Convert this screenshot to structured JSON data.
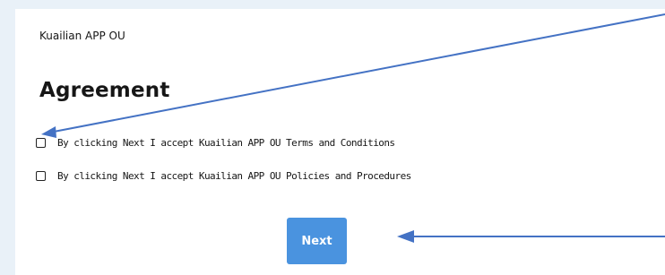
{
  "header": {
    "org_name": "Kuailian APP OU"
  },
  "agreement": {
    "title": "Agreement",
    "items": [
      {
        "label": "By clicking Next I accept Kuailian APP OU Terms and Conditions",
        "checked": false
      },
      {
        "label": "By clicking Next I accept Kuailian APP OU Policies and Procedures",
        "checked": false
      }
    ]
  },
  "actions": {
    "next_label": "Next"
  },
  "colors": {
    "page_background": "#e9f1f8",
    "card_background": "#ffffff",
    "button_primary": "#4a93df",
    "annotation_arrow": "#4472c4"
  }
}
